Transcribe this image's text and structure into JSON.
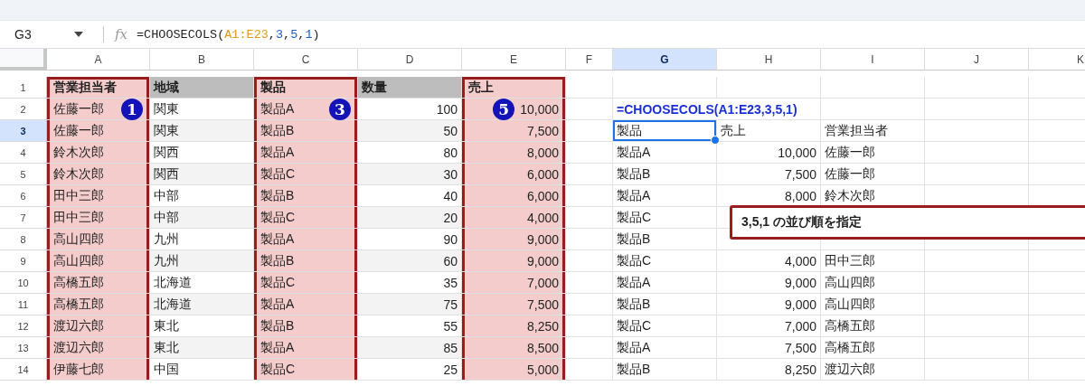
{
  "formula_bar": {
    "name_box": "G3",
    "fx_label": "fx",
    "formula": [
      {
        "kind": "text",
        "text": "=CHOOSECOLS("
      },
      {
        "kind": "range",
        "text": "A1:E23"
      },
      {
        "kind": "text",
        "text": ","
      },
      {
        "kind": "number",
        "text": "3"
      },
      {
        "kind": "text",
        "text": ","
      },
      {
        "kind": "number",
        "text": "5"
      },
      {
        "kind": "text",
        "text": ","
      },
      {
        "kind": "number",
        "text": "1"
      },
      {
        "kind": "text",
        "text": ")"
      }
    ]
  },
  "columns": [
    {
      "label": "A",
      "kind": "highlight",
      "selected": false
    },
    {
      "label": "B",
      "kind": "table",
      "selected": false
    },
    {
      "label": "C",
      "kind": "highlight",
      "selected": false
    },
    {
      "label": "D",
      "kind": "table",
      "selected": false
    },
    {
      "label": "E",
      "kind": "highlight",
      "selected": false
    },
    {
      "label": "F",
      "kind": "plain",
      "selected": false
    },
    {
      "label": "G",
      "kind": "plain",
      "selected": true
    },
    {
      "label": "H",
      "kind": "plain",
      "selected": false
    },
    {
      "label": "I",
      "kind": "plain",
      "selected": false
    },
    {
      "label": "J",
      "kind": "plain",
      "selected": false
    },
    {
      "label": "K",
      "kind": "plain",
      "selected": false
    }
  ],
  "rows": [
    {
      "number": "1",
      "kind": "header",
      "selected": false,
      "cells": [
        {
          "text": "営業担当者"
        },
        {
          "text": "地域"
        },
        {
          "text": "製品"
        },
        {
          "text": "数量"
        },
        {
          "text": "売上"
        },
        null,
        null,
        null,
        null,
        null,
        null
      ]
    },
    {
      "number": "2",
      "kind": "data",
      "striped": false,
      "selected": false,
      "cells": [
        {
          "text": "佐藤一郎",
          "badge": "1"
        },
        {
          "text": "関東"
        },
        {
          "text": "製品A",
          "badge": "3"
        },
        {
          "number": "100"
        },
        {
          "number": "10,000",
          "badge": "5"
        },
        null,
        {
          "formula_text": "=CHOOSECOLS(A1:E23,3,5,1)"
        },
        null,
        null,
        null,
        null
      ]
    },
    {
      "number": "3",
      "kind": "data",
      "striped": true,
      "selected": true,
      "cells": [
        {
          "text": "佐藤一郎"
        },
        {
          "text": "関東"
        },
        {
          "text": "製品B"
        },
        {
          "number": "50"
        },
        {
          "number": "7,500"
        },
        null,
        {
          "text": "製品"
        },
        {
          "text": "売上"
        },
        {
          "text": "営業担当者"
        },
        null,
        null
      ]
    },
    {
      "number": "4",
      "kind": "data",
      "striped": false,
      "selected": false,
      "cells": [
        {
          "text": "鈴木次郎"
        },
        {
          "text": "関西"
        },
        {
          "text": "製品A"
        },
        {
          "number": "80"
        },
        {
          "number": "8,000"
        },
        null,
        {
          "text": "製品A"
        },
        {
          "number": "10,000"
        },
        {
          "text": "佐藤一郎"
        },
        null,
        null
      ]
    },
    {
      "number": "5",
      "kind": "data",
      "striped": true,
      "selected": false,
      "cells": [
        {
          "text": "鈴木次郎"
        },
        {
          "text": "関西"
        },
        {
          "text": "製品C"
        },
        {
          "number": "30"
        },
        {
          "number": "6,000"
        },
        null,
        {
          "text": "製品B"
        },
        {
          "number": "7,500"
        },
        {
          "text": "佐藤一郎"
        },
        null,
        null
      ]
    },
    {
      "number": "6",
      "kind": "data",
      "striped": false,
      "selected": false,
      "cells": [
        {
          "text": "田中三郎"
        },
        {
          "text": "中部"
        },
        {
          "text": "製品B"
        },
        {
          "number": "40"
        },
        {
          "number": "6,000"
        },
        null,
        {
          "text": "製品A"
        },
        {
          "number": "8,000"
        },
        {
          "text": "鈴木次郎"
        },
        null,
        null
      ]
    },
    {
      "number": "7",
      "kind": "data",
      "striped": true,
      "selected": false,
      "cells": [
        {
          "text": "田中三郎"
        },
        {
          "text": "中部"
        },
        {
          "text": "製品C"
        },
        {
          "number": "20"
        },
        {
          "number": "4,000"
        },
        null,
        {
          "text": "製品C"
        },
        null,
        null,
        null,
        null
      ]
    },
    {
      "number": "8",
      "kind": "data",
      "striped": false,
      "selected": false,
      "cells": [
        {
          "text": "高山四郎"
        },
        {
          "text": "九州"
        },
        {
          "text": "製品A"
        },
        {
          "number": "90"
        },
        {
          "number": "9,000"
        },
        null,
        {
          "text": "製品B"
        },
        null,
        null,
        null,
        null
      ]
    },
    {
      "number": "9",
      "kind": "data",
      "striped": true,
      "selected": false,
      "cells": [
        {
          "text": "高山四郎"
        },
        {
          "text": "九州"
        },
        {
          "text": "製品B"
        },
        {
          "number": "60"
        },
        {
          "number": "9,000"
        },
        null,
        {
          "text": "製品C"
        },
        {
          "number": "4,000"
        },
        {
          "text": "田中三郎"
        },
        null,
        null
      ]
    },
    {
      "number": "10",
      "kind": "data",
      "striped": false,
      "selected": false,
      "cells": [
        {
          "text": "高橋五郎"
        },
        {
          "text": "北海道"
        },
        {
          "text": "製品C"
        },
        {
          "number": "35"
        },
        {
          "number": "7,000"
        },
        null,
        {
          "text": "製品A"
        },
        {
          "number": "9,000"
        },
        {
          "text": "高山四郎"
        },
        null,
        null
      ]
    },
    {
      "number": "11",
      "kind": "data",
      "striped": true,
      "selected": false,
      "cells": [
        {
          "text": "高橋五郎"
        },
        {
          "text": "北海道"
        },
        {
          "text": "製品A"
        },
        {
          "number": "75"
        },
        {
          "number": "7,500"
        },
        null,
        {
          "text": "製品B"
        },
        {
          "number": "9,000"
        },
        {
          "text": "高山四郎"
        },
        null,
        null
      ]
    },
    {
      "number": "12",
      "kind": "data",
      "striped": false,
      "selected": false,
      "cells": [
        {
          "text": "渡辺六郎"
        },
        {
          "text": "東北"
        },
        {
          "text": "製品B"
        },
        {
          "number": "55"
        },
        {
          "number": "8,250"
        },
        null,
        {
          "text": "製品C"
        },
        {
          "number": "7,000"
        },
        {
          "text": "高橋五郎"
        },
        null,
        null
      ]
    },
    {
      "number": "13",
      "kind": "data",
      "striped": true,
      "selected": false,
      "cells": [
        {
          "text": "渡辺六郎"
        },
        {
          "text": "東北"
        },
        {
          "text": "製品A"
        },
        {
          "number": "85"
        },
        {
          "number": "8,500"
        },
        null,
        {
          "text": "製品A"
        },
        {
          "number": "7,500"
        },
        {
          "text": "高橋五郎"
        },
        null,
        null
      ]
    },
    {
      "number": "14",
      "kind": "data",
      "striped": false,
      "selected": false,
      "cells": [
        {
          "text": "伊藤七郎"
        },
        {
          "text": "中国"
        },
        {
          "text": "製品C"
        },
        {
          "number": "25"
        },
        {
          "number": "5,000"
        },
        null,
        {
          "text": "製品B"
        },
        {
          "number": "8,250"
        },
        {
          "text": "渡辺六郎"
        },
        null,
        null
      ]
    }
  ],
  "callout": {
    "text": "3,5,1 の並び順を指定"
  }
}
